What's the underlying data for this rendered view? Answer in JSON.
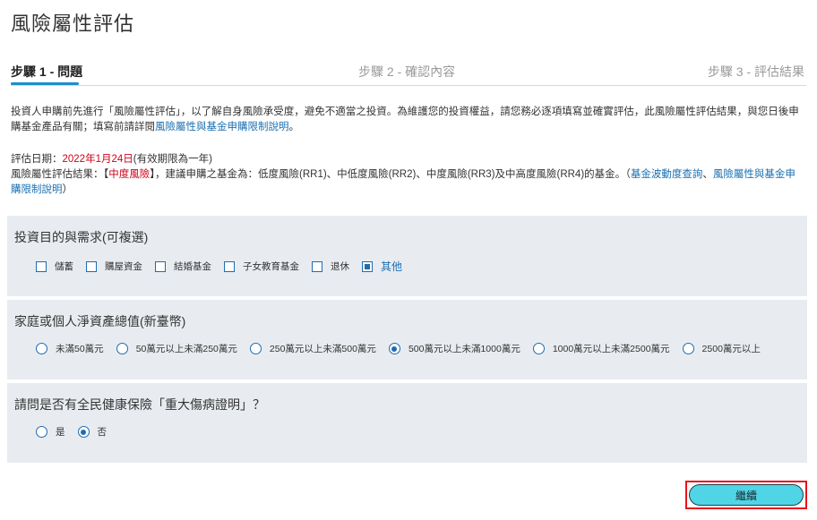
{
  "page": {
    "title": "風險屬性評估"
  },
  "steps": [
    {
      "label": "步驟 1 - 問題"
    },
    {
      "label": "步驟 2 - 確認內容"
    },
    {
      "label": "步驟 3 - 評估結果"
    }
  ],
  "intro": {
    "text": "投資人申購前先進行「風險屬性評估」，以了解自身風險承受度，避免不適當之投資。為維護您的投資權益，請您務必逐項填寫並確實評估，此風險屬性評估結果，與您日後申購基金產品有關；填寫前請詳閱",
    "link": "風險屬性與基金申購限制說明",
    "end": "。"
  },
  "evaluation": {
    "date_prefix": "評估日期：",
    "date": "2022年1月24日",
    "validity": "(有效期限為一年)",
    "result_prefix": "風險屬性評估結果：【",
    "risk_level": "中度風險",
    "result_mid": "】，建議申購之基金為：低度風險(RR1)、中低度風險(RR2)、中度風險(RR3)及中高度風險(RR4)的基金。（",
    "link1": "基金波動度查詢",
    "sep": "、",
    "link2": "風險屬性與基金申購限制說明",
    "result_end": "）"
  },
  "questions": [
    {
      "question": "投資目的與需求(可複選)",
      "type": "checkbox",
      "options": [
        {
          "label": "儲蓄",
          "selected": false
        },
        {
          "label": "購屋資金",
          "selected": false
        },
        {
          "label": "結婚基金",
          "selected": false
        },
        {
          "label": "子女教育基金",
          "selected": false
        },
        {
          "label": "退休",
          "selected": false
        },
        {
          "label": "其他",
          "selected": true
        }
      ]
    },
    {
      "question": "家庭或個人淨資產總值(新臺幣)",
      "type": "radio",
      "options": [
        {
          "label": "未滿50萬元",
          "selected": false
        },
        {
          "label": "50萬元以上未滿250萬元",
          "selected": false
        },
        {
          "label": "250萬元以上未滿500萬元",
          "selected": false
        },
        {
          "label": "500萬元以上未滿1000萬元",
          "selected": true
        },
        {
          "label": "1000萬元以上未滿2500萬元",
          "selected": false
        },
        {
          "label": "2500萬元以上",
          "selected": false
        }
      ]
    },
    {
      "question": "請問是否有全民健康保險「重大傷病證明」？",
      "type": "radio",
      "options": [
        {
          "label": "是",
          "selected": false
        },
        {
          "label": "否",
          "selected": true
        }
      ]
    }
  ],
  "actions": {
    "continue_label": "繼續"
  },
  "colors": {
    "accent_blue": "#1f6cb0",
    "panel_bg": "#e8ecf0",
    "risk_red": "#d0021b",
    "button_cyan": "#50d5e6",
    "highlight_red": "#e8101d"
  }
}
